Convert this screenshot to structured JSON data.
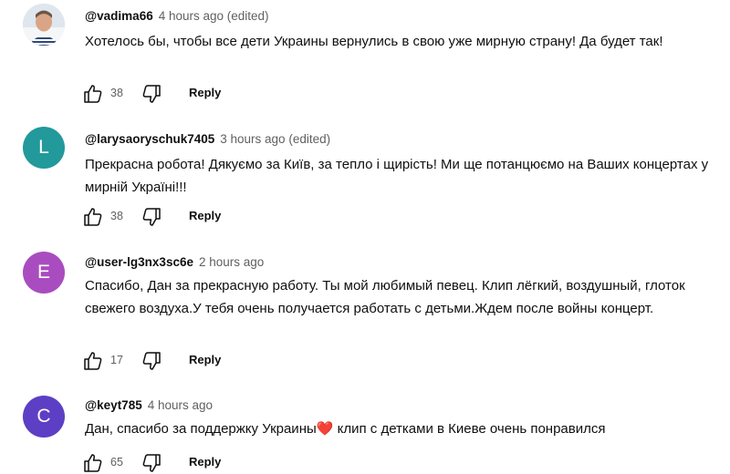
{
  "comments": [
    {
      "author": "@vadima66",
      "meta": "4 hours ago (edited)",
      "text": "Хотелось бы, чтобы все дети Украины вернулись в свою уже мирную страну! Да будет так!",
      "likes": "38",
      "reply_label": "Reply",
      "avatar": {
        "type": "photo"
      }
    },
    {
      "author": "@larysaoryschuk7405",
      "meta": "3 hours ago (edited)",
      "text": "Прекрасна робота! Дякуємо за Київ, за тепло і щирість! Ми ще потанцюємо на Ваших концертах у мирній Україні!!!",
      "likes": "38",
      "reply_label": "Reply",
      "avatar": {
        "type": "letter",
        "letter": "L",
        "color": "#22999b"
      }
    },
    {
      "author": "@user-lg3nx3sc6e",
      "meta": "2 hours ago",
      "text": "Спасибо, Дан за прекрасную работу. Ты мой любимый  певец. Клип лёгкий, воздушный, глоток свежего воздуха.У тебя очень  получается  работать  с детьми.Ждем после войны  концерт.",
      "likes": "17",
      "reply_label": "Reply",
      "avatar": {
        "type": "letter",
        "letter": "E",
        "color": "#a94cbf"
      }
    },
    {
      "author": "@keyt785",
      "meta": "4 hours ago",
      "text_before": "Дан, спасибо за поддержку Украины",
      "emoji": "❤️",
      "text_after": " клип с детками в Киеве очень понравился",
      "likes": "65",
      "reply_label": "Reply",
      "avatar": {
        "type": "letter",
        "letter": "C",
        "color": "#5c3fc4"
      }
    }
  ]
}
